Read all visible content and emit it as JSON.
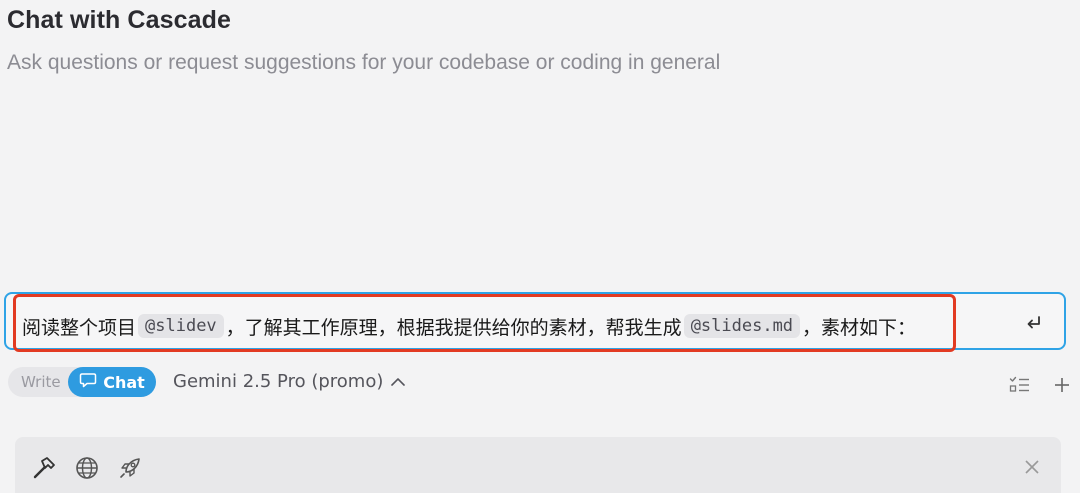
{
  "header": {
    "title": "Chat with Cascade",
    "subtitle": "Ask questions or request suggestions for your codebase or coding in general"
  },
  "input": {
    "segments": [
      {
        "type": "text",
        "text": "阅读整个项目"
      },
      {
        "type": "mention",
        "text": "@slidev"
      },
      {
        "type": "text",
        "text": " ，了解其工作原理，根据我提供给你的素材，帮我生成"
      },
      {
        "type": "mention",
        "text": "@slides.md"
      },
      {
        "type": "text",
        "text": " ，素材如下："
      }
    ],
    "submit_icon": "return-icon"
  },
  "modes": {
    "write_label": "Write",
    "chat_label": "Chat",
    "active": "Chat",
    "chat_icon": "chat-bubble-icon"
  },
  "model": {
    "label": "Gemini 2.5 Pro (promo)",
    "icon": "chevron-up-icon"
  },
  "toolbar_right": {
    "icons": [
      "checklist-icon",
      "plus-icon"
    ]
  },
  "tools": {
    "icons": [
      "hammer-icon",
      "globe-icon",
      "rocket-icon",
      "close-icon"
    ]
  },
  "colors": {
    "accent": "#2e9be0",
    "highlight_border": "#e23a22",
    "background": "#f3f3f4"
  }
}
